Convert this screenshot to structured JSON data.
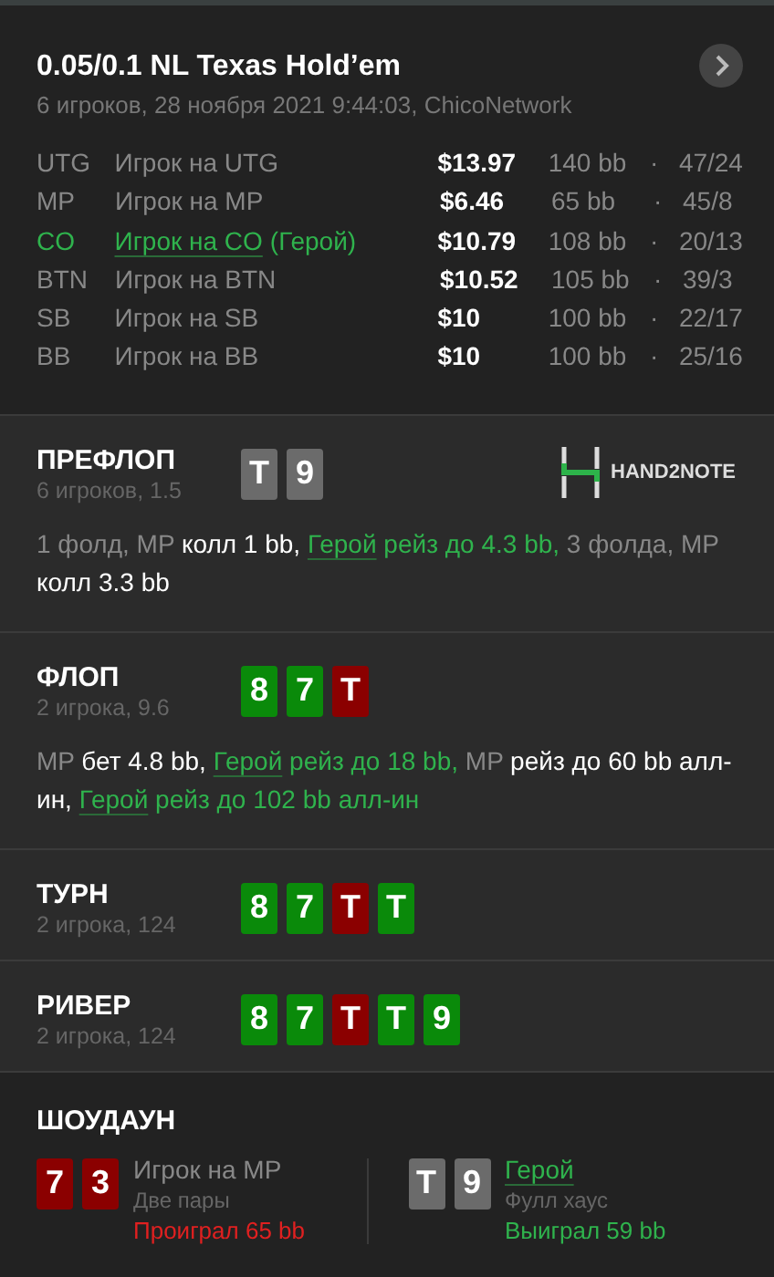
{
  "header": {
    "title": "0.05/0.1 NL Texas Hold’em",
    "subtitle": "6 игроков, 28 ноября 2021 9:44:03, ChicoNetwork"
  },
  "players": [
    {
      "position": "UTG",
      "name": "Игрок на UTG",
      "hero": false,
      "stack": "$13.97",
      "bb": "140 bb",
      "separator": "·",
      "stats": "47/24"
    },
    {
      "position": "MP",
      "name": "Игрок на MP",
      "hero": false,
      "stack": "$6.46",
      "bb": "65 bb",
      "separator": "·",
      "stats": "45/8"
    },
    {
      "position": "CO",
      "name": "Игрок на CO",
      "hero": true,
      "hero_tag": "(Герой)",
      "stack": "$10.79",
      "bb": "108 bb",
      "separator": "·",
      "stats": "20/13"
    },
    {
      "position": "BTN",
      "name": "Игрок на BTN",
      "hero": false,
      "stack": "$10.52",
      "bb": "105 bb",
      "separator": "·",
      "stats": "39/3"
    },
    {
      "position": "SB",
      "name": "Игрок на SB",
      "hero": false,
      "stack": "$10",
      "bb": "100 bb",
      "separator": "·",
      "stats": "22/17"
    },
    {
      "position": "BB",
      "name": "Игрок на BB",
      "hero": false,
      "stack": "$10",
      "bb": "100 bb",
      "separator": "·",
      "stats": "25/16"
    }
  ],
  "logo": {
    "text": "HAND2NOTE"
  },
  "streets": [
    {
      "name": "ПРЕФЛОП",
      "info": "6 игроков, 1.5",
      "cards": [
        {
          "rank": "T",
          "color": "#6b6b6b"
        },
        {
          "rank": "9",
          "color": "#6b6b6b"
        }
      ],
      "actions": [
        {
          "kind": "muted",
          "text": "1 фолд, MP "
        },
        {
          "kind": "act",
          "text": "колл 1 bb, "
        },
        {
          "kind": "hero",
          "text": "Герой"
        },
        {
          "kind": "heroact",
          "text": " рейз до 4.3 bb, "
        },
        {
          "kind": "muted",
          "text": "3 фолда, MP "
        },
        {
          "kind": "act",
          "text": "колл 3.3 bb"
        }
      ]
    },
    {
      "name": "ФЛОП",
      "info": "2 игрока, 9.6",
      "cards": [
        {
          "rank": "8",
          "color": "#0a8a0a"
        },
        {
          "rank": "7",
          "color": "#0a8a0a"
        },
        {
          "rank": "T",
          "color": "#8b0000"
        }
      ],
      "actions": [
        {
          "kind": "muted",
          "text": "MP "
        },
        {
          "kind": "act",
          "text": "бет 4.8 bb, "
        },
        {
          "kind": "hero",
          "text": "Герой"
        },
        {
          "kind": "heroact",
          "text": " рейз до 18 bb, "
        },
        {
          "kind": "muted",
          "text": "MP "
        },
        {
          "kind": "act",
          "text": "рейз до 60 bb алл-ин, "
        },
        {
          "kind": "hero",
          "text": "Герой"
        },
        {
          "kind": "heroact",
          "text": " рейз до 102 bb алл-ин"
        }
      ]
    },
    {
      "name": "ТУРН",
      "info": "2 игрока, 124",
      "cards": [
        {
          "rank": "8",
          "color": "#0a8a0a"
        },
        {
          "rank": "7",
          "color": "#0a8a0a"
        },
        {
          "rank": "T",
          "color": "#8b0000"
        },
        {
          "rank": "T",
          "color": "#0a8a0a"
        }
      ]
    },
    {
      "name": "РИВЕР",
      "info": "2 игрока, 124",
      "cards": [
        {
          "rank": "8",
          "color": "#0a8a0a"
        },
        {
          "rank": "7",
          "color": "#0a8a0a"
        },
        {
          "rank": "T",
          "color": "#8b0000"
        },
        {
          "rank": "T",
          "color": "#0a8a0a"
        },
        {
          "rank": "9",
          "color": "#0a8a0a"
        }
      ]
    }
  ],
  "showdown": {
    "title": "ШОУДАУН",
    "players": [
      {
        "name": "Игрок на MP",
        "hero": false,
        "hand": "Две пары",
        "result": "Проиграл 65 bb",
        "won": false,
        "cards": [
          {
            "rank": "7",
            "color": "#8b0000"
          },
          {
            "rank": "3",
            "color": "#8b0000"
          }
        ]
      },
      {
        "name": "Герой",
        "hero": true,
        "hand": "Фулл хаус",
        "result": "Выиграл 59 bb",
        "won": true,
        "cards": [
          {
            "rank": "T",
            "color": "#6b6b6b"
          },
          {
            "rank": "9",
            "color": "#6b6b6b"
          }
        ]
      }
    ]
  }
}
